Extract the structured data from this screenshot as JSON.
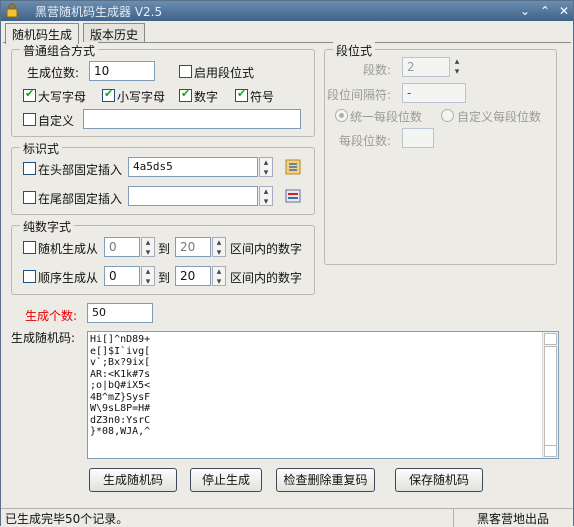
{
  "window": {
    "title": "黑营随机码生成器 V2.5",
    "min_icon": "chevron-down-icon",
    "max_icon": "chevron-up-icon",
    "close_icon": "close-icon"
  },
  "tabs": [
    {
      "label": "随机码生成",
      "active": true
    },
    {
      "label": "版本历史",
      "active": false
    }
  ],
  "normal_group": {
    "legend": "普通组合方式",
    "digits_label": "生成位数:",
    "digits_value": "10",
    "enable_segment_label": "启用段位式",
    "enable_segment_checked": false,
    "uppercase_label": "大写字母",
    "uppercase_checked": true,
    "lowercase_label": "小写字母",
    "lowercase_checked": true,
    "numbers_label": "数字",
    "numbers_checked": true,
    "symbols_label": "符号",
    "symbols_checked": true,
    "custom_label": "自定义",
    "custom_checked": false,
    "custom_value": ""
  },
  "segment_group": {
    "legend": "段位式",
    "segments_label": "段数:",
    "segments_value": "2",
    "separator_label": "段位间隔符:",
    "separator_value": "-",
    "uniform_label": "统一每段位数",
    "uniform_selected": true,
    "custom_each_label": "自定义每段位数",
    "custom_each_selected": false,
    "per_segment_label": "每段位数:",
    "per_segment_value": ""
  },
  "marker_group": {
    "legend": "标识式",
    "head_label": "在头部固定插入",
    "head_checked": false,
    "head_value": "4a5ds5",
    "head_icon": "list-add-icon",
    "tail_label": "在尾部固定插入",
    "tail_checked": false,
    "tail_value": "",
    "tail_icon": "list-remove-icon"
  },
  "pure_number_group": {
    "legend": "纯数字式",
    "random_label": "随机生成从",
    "random_checked": false,
    "random_from": "0",
    "random_to": "20",
    "sequential_label": "顺序生成从",
    "sequential_checked": false,
    "sequential_from": "0",
    "sequential_to": "20",
    "to_word": "到",
    "range_suffix": "区间内的数字"
  },
  "count": {
    "label": "生成个数:",
    "value": "50",
    "label_color": "#e00000"
  },
  "output": {
    "label": "生成随机码:",
    "lines": [
      "Hi[]^nD89+",
      "e[]$I`ivg[",
      "v`;Bx?9ix[",
      "AR:<K1k#7s",
      ";o|bQ#iX5<",
      "4B^mZ}SysF",
      "W\\9sL8P=H#",
      "dZ3n0:YsrC",
      "}*08,WJA,^"
    ]
  },
  "buttons": {
    "generate": "生成随机码",
    "stop": "停止生成",
    "dedupe": "检查删除重复码",
    "save": "保存随机码"
  },
  "status": {
    "left": "已生成完毕50个记录。",
    "right": "黑客营地出品"
  }
}
